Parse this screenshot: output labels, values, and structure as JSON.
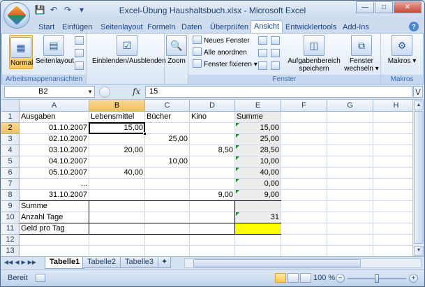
{
  "window": {
    "title": "Excel-Übung Haushaltsbuch.xlsx - Microsoft Excel"
  },
  "ribbon": {
    "tabs": [
      {
        "label": "Start"
      },
      {
        "label": "Einfügen"
      },
      {
        "label": "Seitenlayout"
      },
      {
        "label": "Formeln"
      },
      {
        "label": "Daten"
      },
      {
        "label": "Überprüfen"
      },
      {
        "label": "Ansicht"
      },
      {
        "label": "Entwicklertools"
      },
      {
        "label": "Add-Ins"
      }
    ],
    "active_tab": "Ansicht",
    "groups": {
      "arbeitsmappenansichten": {
        "label": "Arbeitsmappenansichten",
        "normal": "Normal",
        "seitenlayout": "Seitenlayout"
      },
      "einblenden": {
        "label": "Einblenden/Ausblenden"
      },
      "zoom": {
        "label": "Zoom"
      },
      "fenster": {
        "label": "Fenster",
        "neues_fenster": "Neues Fenster",
        "alle_anordnen": "Alle anordnen",
        "fenster_fixieren": "Fenster fixieren",
        "arbeitsbereich_line1": "Aufgabenbereich",
        "arbeitsbereich_line2": "speichern",
        "wechseln_line1": "Fenster",
        "wechseln_line2": "wechseln"
      },
      "makros": {
        "label": "Makros",
        "button": "Makros"
      }
    }
  },
  "formula_bar": {
    "name_box": "B2",
    "fx": "fx",
    "value": "15"
  },
  "sheet": {
    "columns": [
      "A",
      "B",
      "C",
      "D",
      "E",
      "F",
      "G",
      "H"
    ],
    "selected_column": "B",
    "selected_row": "2",
    "rows": [
      {
        "n": "1",
        "A": "Ausgaben",
        "B": "Lebensmittel",
        "C": "Bücher",
        "D": "Kino",
        "E": "Summe"
      },
      {
        "n": "2",
        "A": "01.10.2007",
        "B": "15,00",
        "C": "",
        "D": "",
        "E": "15,00"
      },
      {
        "n": "3",
        "A": "02.10.2007",
        "B": "",
        "C": "25,00",
        "D": "",
        "E": "25,00"
      },
      {
        "n": "4",
        "A": "03.10.2007",
        "B": "20,00",
        "C": "",
        "D": "8,50",
        "E": "28,50"
      },
      {
        "n": "5",
        "A": "04.10.2007",
        "B": "",
        "C": "10,00",
        "D": "",
        "E": "10,00"
      },
      {
        "n": "6",
        "A": "05.10.2007",
        "B": "40,00",
        "C": "",
        "D": "",
        "E": "40,00"
      },
      {
        "n": "7",
        "A": "...",
        "B": "",
        "C": "",
        "D": "",
        "E": "0,00"
      },
      {
        "n": "8",
        "A": "31.10.2007",
        "B": "",
        "C": "",
        "D": "9,00",
        "E": "9,00"
      },
      {
        "n": "9",
        "A": "Summe",
        "B": "",
        "C": "",
        "D": "",
        "E": ""
      },
      {
        "n": "10",
        "A": "Anzahl Tage",
        "B": "",
        "C": "",
        "D": "",
        "E": "31"
      },
      {
        "n": "11",
        "A": "Geld pro Tag",
        "B": "",
        "C": "",
        "D": "",
        "E": ""
      },
      {
        "n": "12",
        "A": "",
        "B": "",
        "C": "",
        "D": "",
        "E": ""
      },
      {
        "n": "13",
        "A": "",
        "B": "",
        "C": "",
        "D": "",
        "E": ""
      }
    ]
  },
  "sheet_tabs": [
    {
      "label": "Tabelle1"
    },
    {
      "label": "Tabelle2"
    },
    {
      "label": "Tabelle3"
    }
  ],
  "active_sheet": "Tabelle1",
  "status_bar": {
    "status": "Bereit",
    "zoom": "100 %"
  },
  "colors": {
    "highlight_yellow": "#ffff00",
    "sum_column_gray": "#ededed",
    "ribbon_blue": "#15428b"
  }
}
